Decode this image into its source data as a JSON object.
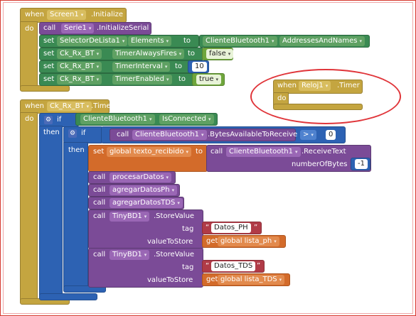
{
  "init_event": {
    "when": "when",
    "component": "Screen1",
    "event": ".Initialize",
    "do": "do"
  },
  "init_call": {
    "call": "call",
    "component": "Serie1",
    "method": ".InitializeSerial"
  },
  "set_elements": {
    "set": "set",
    "component": "SelectorDeLista1",
    "prop": "Elements",
    "to": "to",
    "value_component": "ClienteBluetooth1",
    "value_prop": "AddressesAndNames"
  },
  "set_always": {
    "set": "set",
    "component": "Ck_Rx_BT",
    "prop": "TimerAlwaysFires",
    "to": "to",
    "value": "false"
  },
  "set_interval": {
    "set": "set",
    "component": "Ck_Rx_BT",
    "prop": "TimerInterval",
    "to": "to",
    "value": "10"
  },
  "set_enabled": {
    "set": "set",
    "component": "Ck_Rx_BT",
    "prop": "TimerEnabled",
    "to": "to",
    "value": "true"
  },
  "reloj_event": {
    "when": "when",
    "component": "Reloj1",
    "event": ".Timer",
    "do": "do"
  },
  "timer_event": {
    "when": "when",
    "component": "Ck_Rx_BT",
    "event": ".Timer",
    "do": "do"
  },
  "if_outer": {
    "if": "if",
    "then": "then",
    "component": "ClienteBluetooth1",
    "prop": "IsConnected"
  },
  "if_inner": {
    "if": "if",
    "then": "then",
    "call": "call",
    "component": "ClienteBluetooth1",
    "method": ".BytesAvailableToReceive",
    "op": ">",
    "value": "0"
  },
  "set_global": {
    "set": "set",
    "var": "global texto_recibido",
    "to": "to",
    "call": "call",
    "component": "ClienteBluetooth1",
    "method": ".ReceiveText",
    "arg_label": "numberOfBytes",
    "arg_value": "-1"
  },
  "procedures": [
    {
      "call": "call",
      "name": "procesarDatos"
    },
    {
      "call": "call",
      "name": "agregarDatosPh"
    },
    {
      "call": "call",
      "name": "agregarDatosTDS"
    }
  ],
  "store1": {
    "call": "call",
    "component": "TinyBD1",
    "method": ".StoreValue",
    "tag_label": "tag",
    "tag_value": "Datos_PH",
    "vts_label": "valueToStore",
    "get": "get",
    "var": "global lista_ph"
  },
  "store2": {
    "call": "call",
    "component": "TinyBD1",
    "method": ".StoreValue",
    "tag_label": "tag",
    "tag_value": "Datos_TDS",
    "vts_label": "valueToStore",
    "get": "get",
    "var": "global lista_TDS"
  },
  "caret": "▾",
  "gear_symbol": "⚙",
  "quote_open": "“",
  "quote_close": "”",
  "colors": {
    "event": "#c4a540",
    "call": "#7b4b97",
    "set": "#3a8a53",
    "logic": "#2d62b3",
    "variable": "#d36b2a",
    "annotation": "#e0353a"
  }
}
